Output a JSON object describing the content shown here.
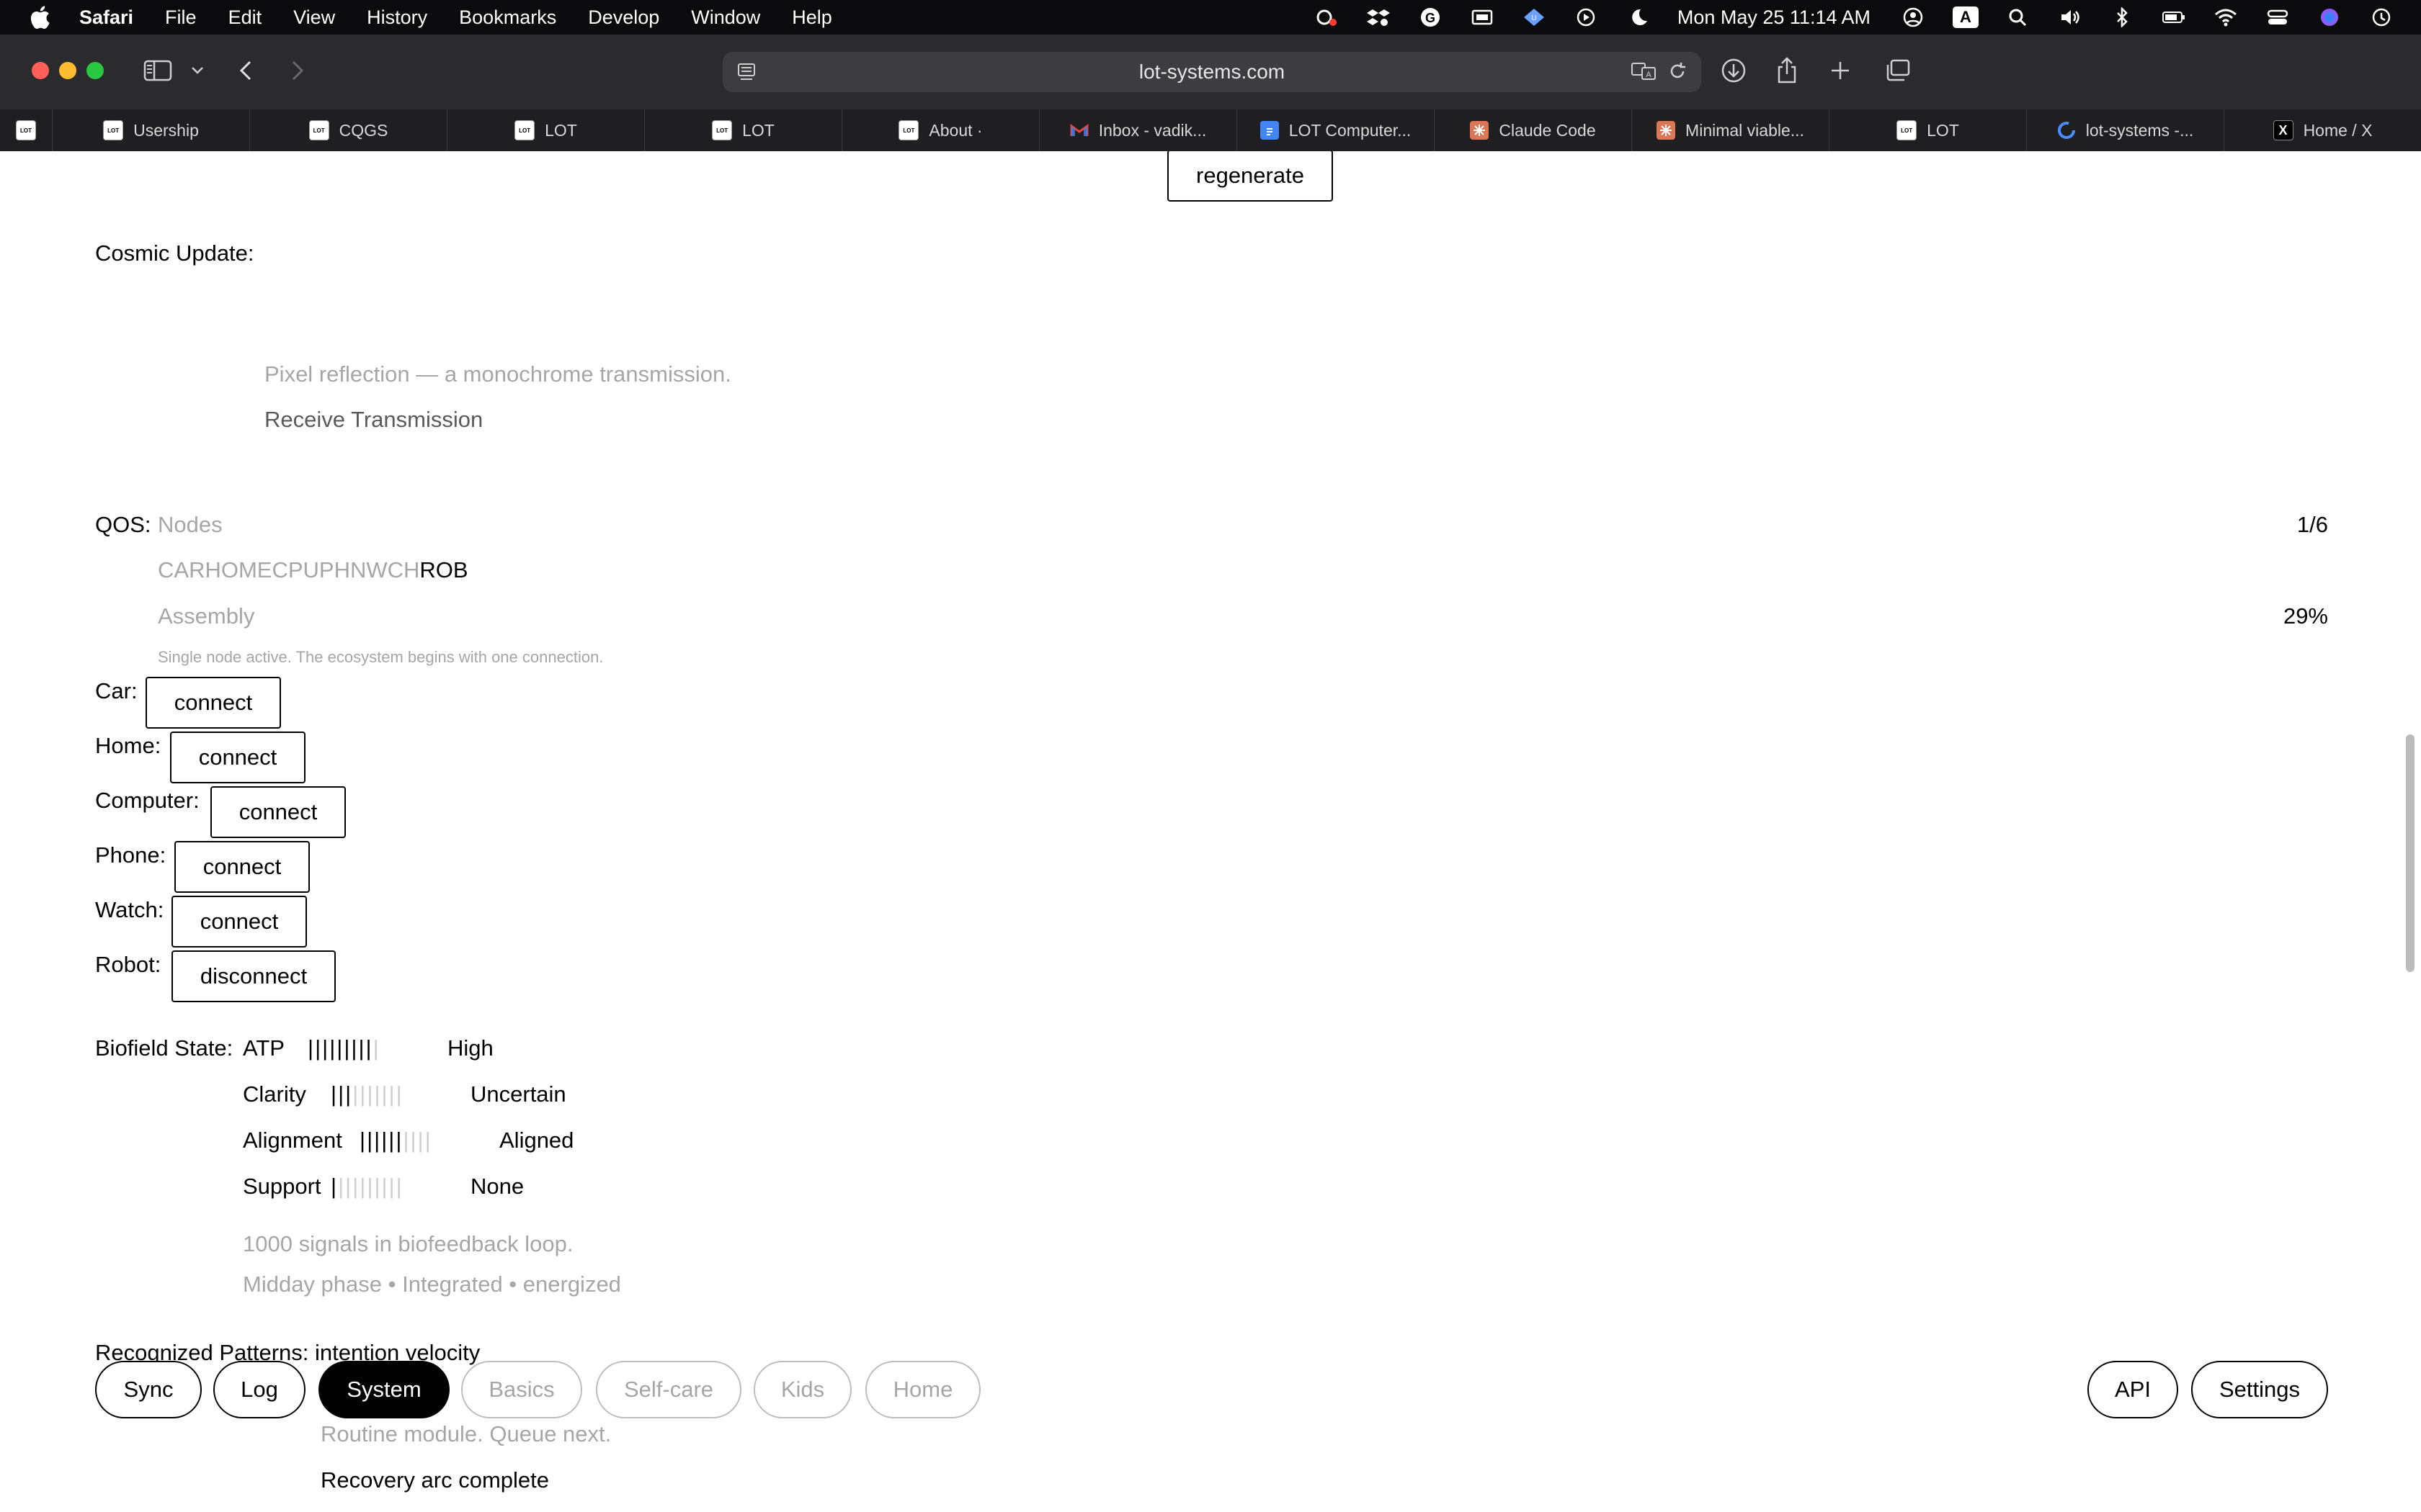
{
  "menubar": {
    "app": "Safari",
    "items": [
      "File",
      "Edit",
      "View",
      "History",
      "Bookmarks",
      "Develop",
      "Window",
      "Help"
    ],
    "clock": "Mon May 25  11:14 AM",
    "input_source": "A"
  },
  "toolbar": {
    "url": "lot-systems.com"
  },
  "tabs": {
    "pinned_favicon": "LOT",
    "items": [
      {
        "label": "Usership",
        "favicon": "lot"
      },
      {
        "label": "CQGS",
        "favicon": "lot"
      },
      {
        "label": "LOT",
        "favicon": "lot"
      },
      {
        "label": "LOT",
        "favicon": "lot"
      },
      {
        "label": "About ·",
        "favicon": "lot"
      },
      {
        "label": "Inbox - vadik...",
        "favicon": "gmail"
      },
      {
        "label": "LOT Computer...",
        "favicon": "doc"
      },
      {
        "label": "Claude Code",
        "favicon": "claude"
      },
      {
        "label": "Minimal viable...",
        "favicon": "claude"
      },
      {
        "label": "LOT",
        "favicon": "lot"
      },
      {
        "label": "lot-systems -...",
        "favicon": "github"
      },
      {
        "label": "Home / X",
        "favicon": "x"
      }
    ],
    "lot_favicon_text": "LOT",
    "x_favicon_text": "X"
  },
  "page": {
    "regenerate_label": "regenerate",
    "cosmic": {
      "label": "Cosmic Update:",
      "transmission": "Pixel reflection — a monochrome transmission.",
      "receive_label": "Receive Transmission"
    },
    "qos": {
      "label": "QOS:",
      "nodes_label": "Nodes",
      "nodes_count": "1/6",
      "node_codes_inactive": "CARHOMECPUPHNWCH",
      "node_code_active": "ROB",
      "assembly_label": "Assembly",
      "assembly_pct": "29%",
      "note": "Single node active. The ecosystem begins with one connection."
    },
    "devices": [
      {
        "name": "Car:",
        "action": "connect"
      },
      {
        "name": "Home:",
        "action": "connect"
      },
      {
        "name": "Computer:",
        "action": "connect"
      },
      {
        "name": "Phone:",
        "action": "connect"
      },
      {
        "name": "Watch:",
        "action": "connect"
      },
      {
        "name": "Robot:",
        "action": "disconnect"
      }
    ],
    "biofield": {
      "label": "Biofield State:",
      "metrics": [
        {
          "name": "ATP",
          "filled": 9,
          "total": 10,
          "state": "High"
        },
        {
          "name": "Clarity",
          "filled": 3,
          "total": 10,
          "state": "Uncertain"
        },
        {
          "name": "Alignment",
          "filled": 6,
          "total": 10,
          "state": "Aligned"
        },
        {
          "name": "Support",
          "filled": 1,
          "total": 10,
          "state": "None"
        }
      ],
      "signals": "1000 signals in biofeedback loop.",
      "phase": "Midday phase • Integrated • energized"
    },
    "patterns": {
      "label": "Recognized Patterns:",
      "value": "intention velocity"
    },
    "routine": {
      "note": "Routine module. Queue next.",
      "status": "Recovery arc complete"
    }
  },
  "nav": {
    "left": [
      {
        "label": "Sync",
        "state": "normal"
      },
      {
        "label": "Log",
        "state": "normal"
      },
      {
        "label": "System",
        "state": "active"
      },
      {
        "label": "Basics",
        "state": "muted"
      },
      {
        "label": "Self-care",
        "state": "muted"
      },
      {
        "label": "Kids",
        "state": "muted"
      },
      {
        "label": "Home",
        "state": "muted"
      }
    ],
    "right": [
      {
        "label": "API"
      },
      {
        "label": "Settings"
      }
    ]
  }
}
